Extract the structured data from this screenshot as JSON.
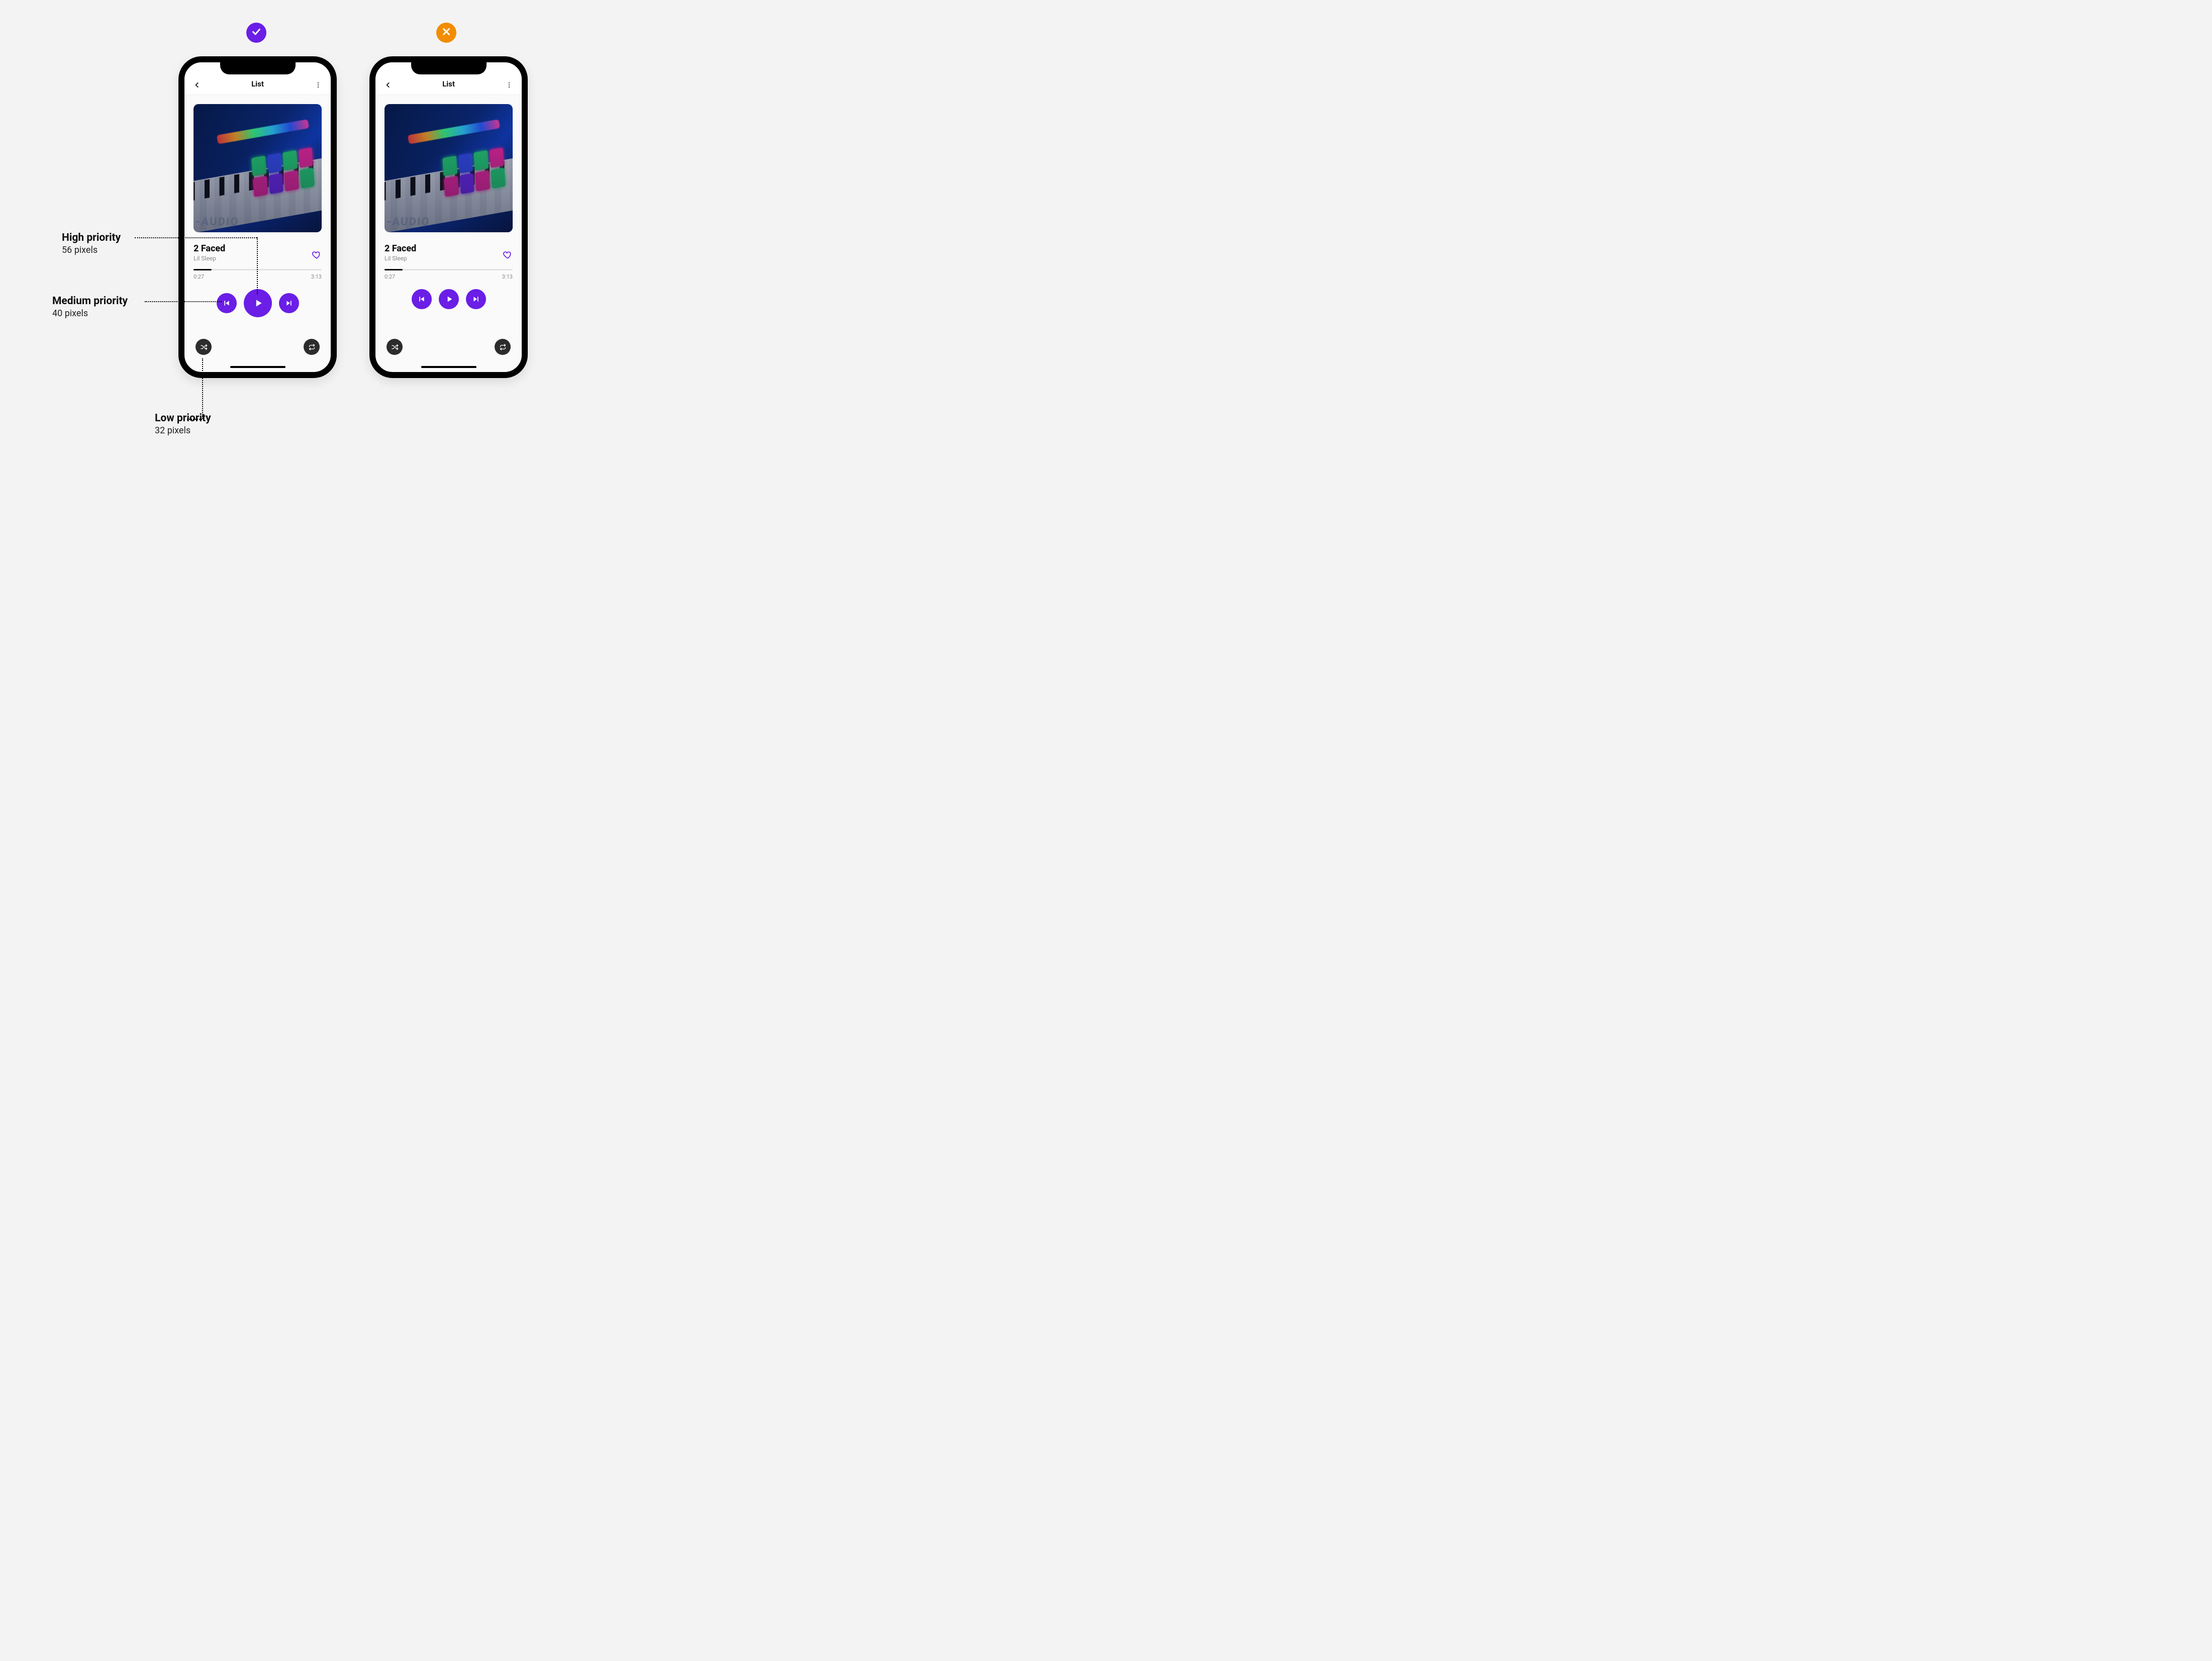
{
  "badges": {
    "do": "check",
    "dont": "cross"
  },
  "phone": {
    "header": {
      "title": "List"
    },
    "album_brand": "-AUDIO",
    "track": {
      "title": "2 Faced",
      "artist": "Lil Sleep"
    },
    "time": {
      "elapsed": "0:27",
      "total": "3:13"
    }
  },
  "annotations": {
    "high": {
      "title": "High priority",
      "sub": "56 pixels"
    },
    "medium": {
      "title": "Medium priority",
      "sub": "40 pixels"
    },
    "low": {
      "title": "Low priority",
      "sub": "32 pixels"
    }
  },
  "colors": {
    "accent_purple": "#6a1ee6",
    "accent_orange": "#f28c00",
    "dark_button": "#2c2c2c",
    "page_bg": "#f3f3f3"
  },
  "button_sizes": {
    "do": {
      "prev": 40,
      "play": 56,
      "next": 40,
      "shuffle": 32,
      "repeat": 32
    },
    "dont": {
      "prev": 40,
      "play": 40,
      "next": 40,
      "shuffle": 32,
      "repeat": 32
    }
  }
}
